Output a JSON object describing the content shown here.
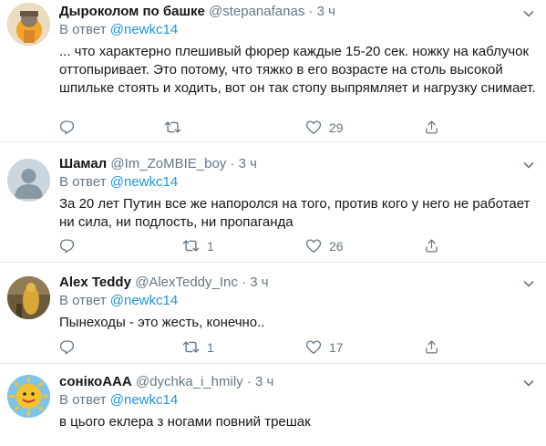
{
  "tweets": [
    {
      "name": "Дыроколом по башке",
      "handle": "@stepanafanas",
      "time": "3 ч",
      "reply_prefix": "В ответ",
      "reply_mention": "@newkc14",
      "text": "... что характерно плешивый фюрер каждые 15-20 сек. ножку на каблучок оттопыривает. Это потому, что тяжко в его возрасте на столь высокой шпильке стоять и ходить, вот он так стопу выпрямляет и нагрузку снимает.",
      "retweets": "",
      "likes": "29"
    },
    {
      "name": "Шамал",
      "handle": "@Im_ZoMBIE_boy",
      "time": "3 ч",
      "reply_prefix": "В ответ",
      "reply_mention": "@newkc14",
      "text": "За 20 лет Путин все же напоролся на того,  против кого у него не работает ни сила, ни подлость, ни пропаганда",
      "retweets": "1",
      "likes": "26"
    },
    {
      "name": "Alex Teddy",
      "handle": "@AlexTeddy_Inc",
      "time": "3 ч",
      "reply_prefix": "В ответ",
      "reply_mention": "@newkc14",
      "text": "Пынеходы - это жесть, конечно..",
      "retweets": "1",
      "likes": "17"
    },
    {
      "name": "сонікоААА",
      "handle": "@dychka_i_hmily",
      "time": "3 ч",
      "reply_prefix": "В ответ",
      "reply_mention": "@newkc14",
      "text": "в цього еклера з ногами повний трешак",
      "retweets": "",
      "likes": ""
    }
  ],
  "icons": {
    "reply": "reply-icon",
    "retweet": "retweet-icon",
    "like": "heart-icon",
    "share": "share-icon",
    "more": "chevron-down-icon"
  },
  "colors": {
    "text": "#14171a",
    "secondary": "#657786",
    "link": "#1b95e0",
    "divider": "#e6ecf0"
  }
}
